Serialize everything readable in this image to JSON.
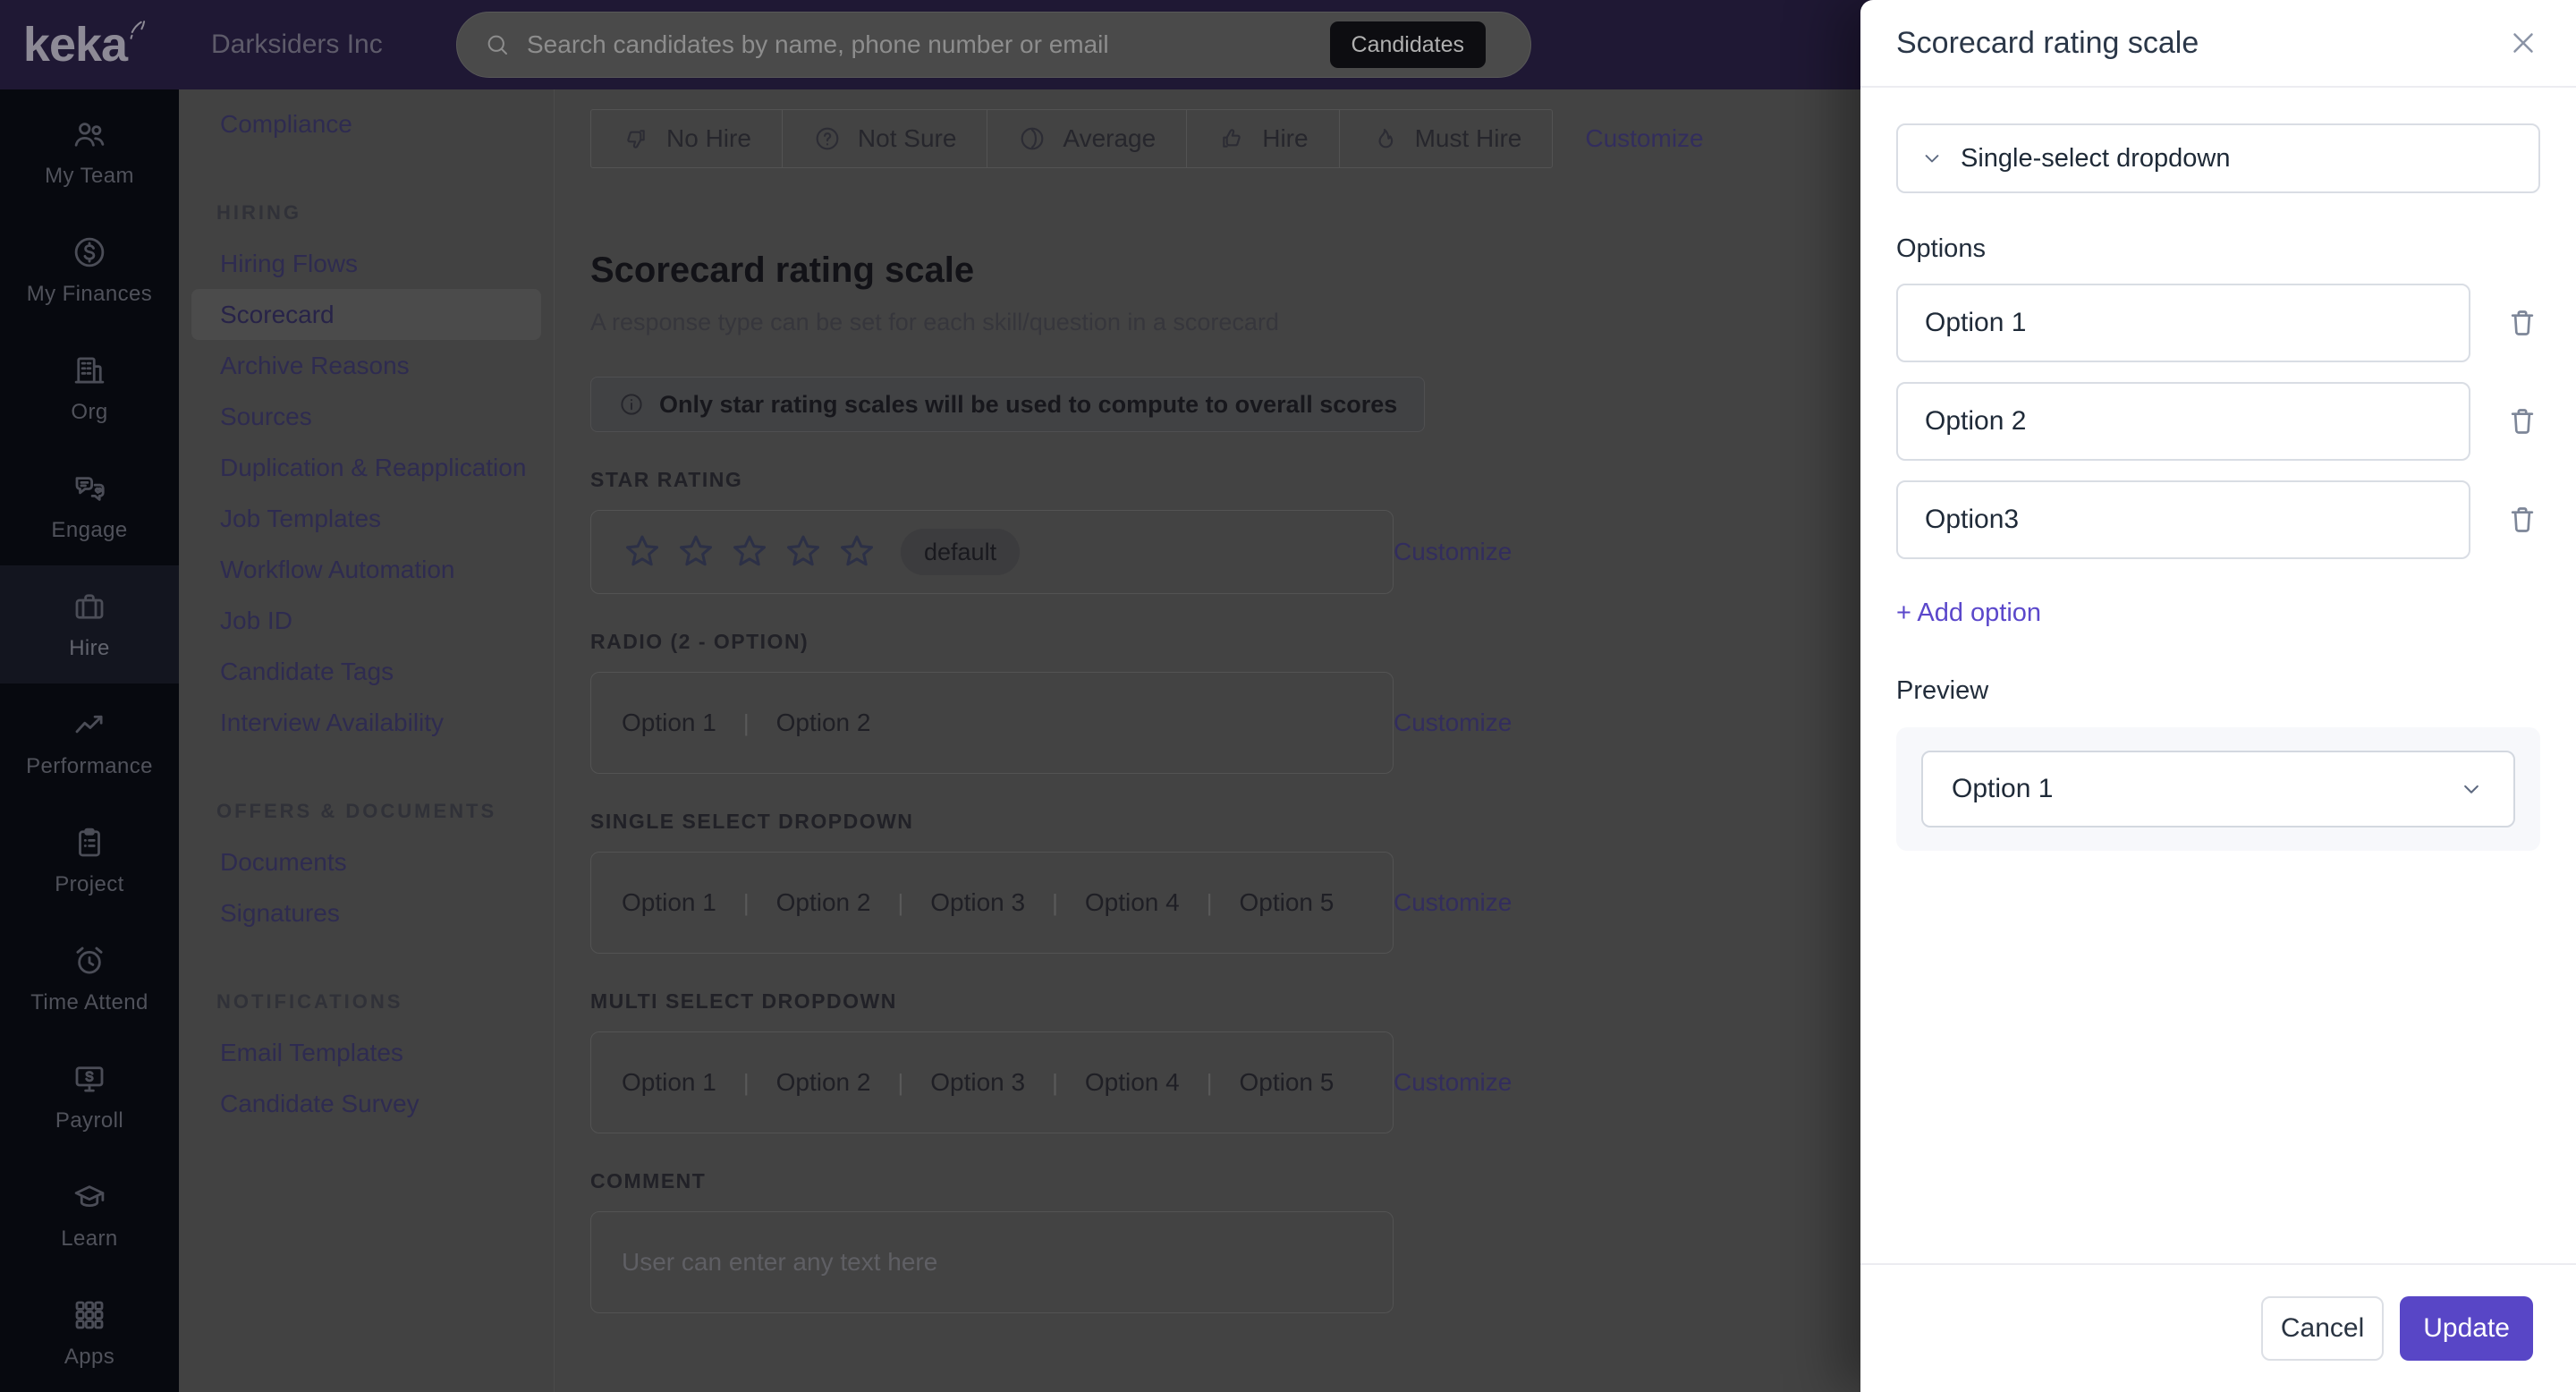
{
  "topbar": {
    "logo_text": "keka",
    "company": "Darksiders Inc",
    "search_placeholder": "Search candidates by name, phone number or email",
    "search_scope": "Candidates"
  },
  "sidebar": {
    "items": [
      {
        "label": "My Team",
        "icon": "team-icon"
      },
      {
        "label": "My Finances",
        "icon": "finances-icon"
      },
      {
        "label": "Org",
        "icon": "org-icon"
      },
      {
        "label": "Engage",
        "icon": "engage-icon"
      },
      {
        "label": "Hire",
        "icon": "briefcase-icon",
        "active": true
      },
      {
        "label": "Performance",
        "icon": "performance-icon"
      },
      {
        "label": "Project",
        "icon": "project-icon"
      },
      {
        "label": "Time Attend",
        "icon": "time-attend-icon"
      },
      {
        "label": "Payroll",
        "icon": "payroll-icon"
      },
      {
        "label": "Learn",
        "icon": "learn-icon"
      },
      {
        "label": "Apps",
        "icon": "apps-icon"
      }
    ]
  },
  "subnav": {
    "top_items": [
      {
        "label": "Compliance"
      }
    ],
    "sections": [
      {
        "header": "HIRING",
        "items": [
          "Hiring Flows",
          "Scorecard",
          "Archive Reasons",
          "Sources",
          "Duplication & Reapplication",
          "Job Templates",
          "Workflow Automation",
          "Job ID",
          "Candidate Tags",
          "Interview Availability"
        ],
        "active_item": "Scorecard"
      },
      {
        "header": "OFFERS & DOCUMENTS",
        "items": [
          "Documents",
          "Signatures"
        ]
      },
      {
        "header": "NOTIFICATIONS",
        "items": [
          "Email Templates",
          "Candidate Survey"
        ]
      }
    ]
  },
  "main": {
    "rating_buttons": [
      {
        "icon": "thumbs-down-icon",
        "label": "No Hire"
      },
      {
        "icon": "question-circle-icon",
        "label": "Not Sure"
      },
      {
        "icon": "gauge-icon",
        "label": "Average"
      },
      {
        "icon": "thumbs-up-icon",
        "label": "Hire"
      },
      {
        "icon": "flame-icon",
        "label": "Must Hire"
      }
    ],
    "customize_label": "Customize",
    "title": "Scorecard rating scale",
    "subtitle": "A response type can be set for each skill/question in a scorecard",
    "info_note": "Only star rating scales will be used to compute to overall scores",
    "sections": {
      "star_rating": {
        "label": "STAR RATING",
        "stars": 5,
        "badge": "default"
      },
      "radio": {
        "label": "RADIO (2 - OPTION)",
        "options": [
          "Option 1",
          "Option 2"
        ]
      },
      "single_select": {
        "label": "SINGLE SELECT DROPDOWN",
        "options": [
          "Option 1",
          "Option 2",
          "Option 3",
          "Option 4",
          "Option 5"
        ]
      },
      "multi_select": {
        "label": "MULTI SELECT DROPDOWN",
        "options": [
          "Option 1",
          "Option 2",
          "Option 3",
          "Option 4",
          "Option 5"
        ]
      },
      "comment": {
        "label": "COMMENT",
        "placeholder": "User can enter any text here"
      }
    }
  },
  "drawer": {
    "title": "Scorecard rating scale",
    "type_selector": {
      "value": "Single-select dropdown"
    },
    "options_label": "Options",
    "options": [
      "Option 1",
      "Option 2",
      "Option3"
    ],
    "add_option_label": "+ Add option",
    "preview_label": "Preview",
    "preview_value": "Option 1",
    "cancel_label": "Cancel",
    "update_label": "Update"
  },
  "colors": {
    "accent_purple": "#5846c6",
    "link_purple": "#5b48cb",
    "topbar_bg": "#1f1834",
    "sidenav_bg": "#07090f",
    "dimmed_content_bg": "#434343",
    "panel_bg": "#ffffff"
  }
}
